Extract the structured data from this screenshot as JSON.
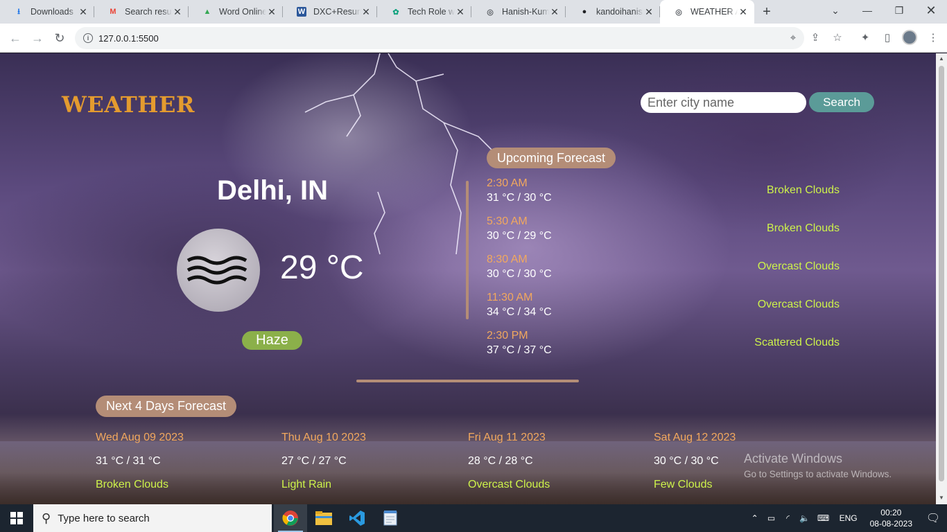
{
  "browser": {
    "tabs": [
      {
        "title": "Downloads",
        "favicon": "download-icon",
        "color": "#1a73e8"
      },
      {
        "title": "Search results",
        "favicon": "gmail-icon",
        "color": "#ea4335"
      },
      {
        "title": "Word Online",
        "favicon": "drive-icon",
        "color": "#34a853"
      },
      {
        "title": "DXC+Resume",
        "favicon": "word-icon",
        "color": "#2b579a"
      },
      {
        "title": "Tech Role with",
        "favicon": "chatgpt-icon",
        "color": "#10a37f"
      },
      {
        "title": "Hanish-Kuma",
        "favicon": "globe-icon",
        "color": "#5f6368"
      },
      {
        "title": "kandoihanish",
        "favicon": "github-icon",
        "color": "#202124"
      },
      {
        "title": "WEATHER AP",
        "favicon": "globe-icon",
        "color": "#5f6368",
        "active": true
      }
    ],
    "url": "127.0.0.1:5500"
  },
  "app": {
    "logo": "WEATHER",
    "search": {
      "placeholder": "Enter city name",
      "button": "Search"
    },
    "current": {
      "city": "Delhi, IN",
      "temp": "29 °C",
      "condition": "Haze",
      "icon": "haze-icon"
    },
    "upcoming": {
      "title": "Upcoming Forecast",
      "items": [
        {
          "time": "2:30 AM",
          "range": "31 °C / 30 °C",
          "desc": "Broken Clouds"
        },
        {
          "time": "5:30 AM",
          "range": "30 °C / 29 °C",
          "desc": "Broken Clouds"
        },
        {
          "time": "8:30 AM",
          "range": "30 °C / 30 °C",
          "desc": "Overcast Clouds"
        },
        {
          "time": "11:30 AM",
          "range": "34 °C / 34 °C",
          "desc": "Overcast Clouds"
        },
        {
          "time": "2:30 PM",
          "range": "37 °C / 37 °C",
          "desc": "Scattered Clouds"
        }
      ]
    },
    "next_days": {
      "title": "Next 4 Days Forecast",
      "items": [
        {
          "date": "Wed Aug 09 2023",
          "range": "31 °C / 31 °C",
          "desc": "Broken Clouds"
        },
        {
          "date": "Thu Aug 10 2023",
          "range": "27 °C / 27 °C",
          "desc": "Light Rain"
        },
        {
          "date": "Fri Aug 11 2023",
          "range": "28 °C / 28 °C",
          "desc": "Overcast Clouds"
        },
        {
          "date": "Sat Aug 12 2023",
          "range": "30 °C / 30 °C",
          "desc": "Few Clouds"
        }
      ]
    }
  },
  "watermark": {
    "line1": "Activate Windows",
    "line2": "Go to Settings to activate Windows."
  },
  "taskbar": {
    "search_placeholder": "Type here to search",
    "language": "ENG",
    "time": "00:20",
    "date": "08-08-2023"
  },
  "colors": {
    "accent": "#e49b2f",
    "tag": "#b48d77",
    "search_btn": "#5b9b98",
    "condition": "#8bb04a",
    "desc": "#cdf24a",
    "time": "#f2a85e"
  }
}
